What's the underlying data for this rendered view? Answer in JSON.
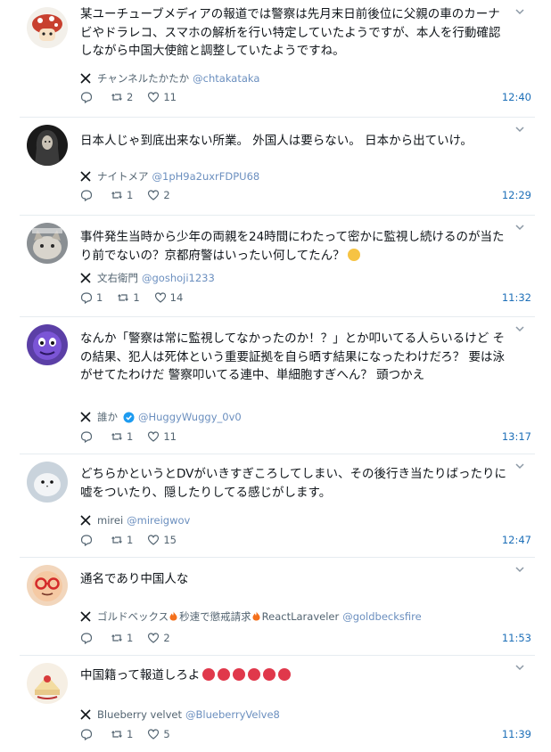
{
  "posts": [
    {
      "text": "某ユーチューブメディアの報道では警察は先月末日前後位に父親の車のカーナビやドラレコ、スマホの解析を行い特定していたようですが、本人を行動確認しながら中国大使館と調整していたようですね。",
      "author_name": "チャンネルたかたか",
      "handle": "@chtakataka",
      "replies": "",
      "retweets": "2",
      "likes": "11",
      "time": "12:40",
      "avatar": "mushroom-avatar"
    },
    {
      "text": "日本人じゃ到底出来ない所業。 外国人は要らない。 日本から出ていけ。",
      "author_name": "ナイトメア",
      "handle": "@1pH9a2uxrFDPU68",
      "replies": "",
      "retweets": "1",
      "likes": "2",
      "time": "12:29",
      "avatar": "dark-figure-avatar"
    },
    {
      "text": "事件発生当時から少年の両親を24時間にわたって密かに監視し続けるのが当たり前でないの？京都府警はいったい何してたん？",
      "author_name": "文右衛門",
      "handle": "@goshoji1233",
      "replies": "1",
      "retweets": "1",
      "likes": "14",
      "time": "11:32",
      "avatar": "cat-avatar"
    },
    {
      "text": "なんか「警察は常に監視してなかったのか！？」とか叩いてる人らいるけど その結果、犯人は死体という重要証拠を自ら晒す結果になったわけだろ？ 要は泳がせてたわけだ 警察叩いてる連中、単細胞すぎへん？ 頭つかえ",
      "author_name": "誰か",
      "handle": "@HuggyWuggy_0v0",
      "replies": "",
      "retweets": "1",
      "likes": "11",
      "time": "13:17",
      "avatar": "purple-character-avatar"
    },
    {
      "text": "どちらかというとDVがいきすぎころしてしまい、その後行き当たりばったりに嘘をついたり、隠したりしてる感じがします。",
      "author_name": "mirei",
      "handle": "@mireigwov",
      "replies": "",
      "retweets": "1",
      "likes": "15",
      "time": "12:47",
      "avatar": "bird-avatar"
    },
    {
      "text": "通名であり中国人な",
      "author_name_parts": [
        "ゴルドベックス",
        "秒速で懲戒請求",
        "ReactLaraveler"
      ],
      "handle": "@goldbecksfire",
      "replies": "",
      "retweets": "1",
      "likes": "2",
      "time": "11:53",
      "avatar": "glasses-face-avatar"
    },
    {
      "text": "中国籍って報道しろよ",
      "author_name": "Blueberry velvet",
      "handle": "@BlueberryVelve8",
      "replies": "",
      "retweets": "1",
      "likes": "5",
      "time": "11:39",
      "avatar": "cake-avatar"
    }
  ],
  "colors": {
    "handle": "#6b8fbf",
    "time": "#1d6fb8",
    "meta": "#536471",
    "divider": "#e6ecf0",
    "verified": "#1d9bf0"
  }
}
